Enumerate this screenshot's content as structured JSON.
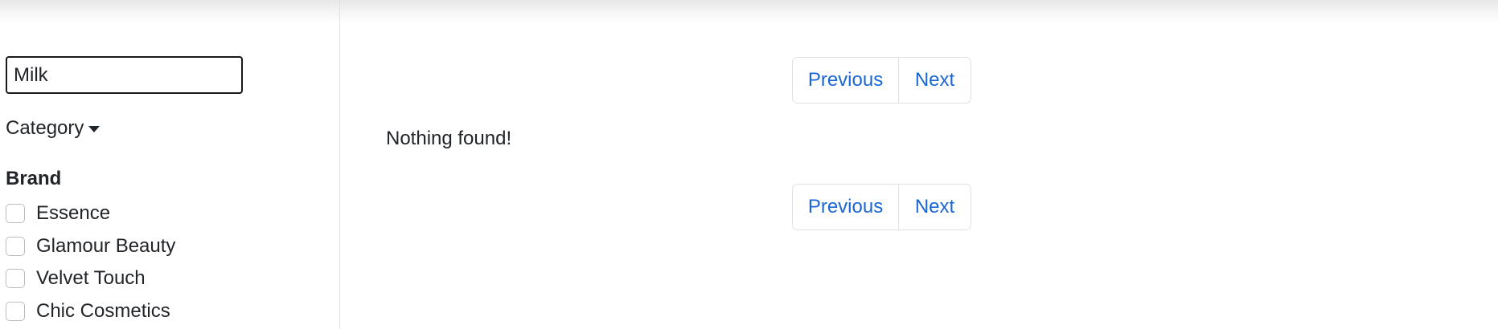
{
  "sidebar": {
    "search": {
      "value": "Milk",
      "placeholder": ""
    },
    "category_label": "Category",
    "brand_heading": "Brand",
    "brands": [
      {
        "label": "Essence",
        "checked": false
      },
      {
        "label": "Glamour Beauty",
        "checked": false
      },
      {
        "label": "Velvet Touch",
        "checked": false
      },
      {
        "label": "Chic Cosmetics",
        "checked": false
      }
    ]
  },
  "main": {
    "pagination_top": {
      "previous_label": "Previous",
      "next_label": "Next"
    },
    "empty_message": "Nothing found!",
    "pagination_bottom": {
      "previous_label": "Previous",
      "next_label": "Next"
    }
  },
  "colors": {
    "link": "#1a66d6",
    "text": "#212529",
    "border": "#dee2e6"
  }
}
